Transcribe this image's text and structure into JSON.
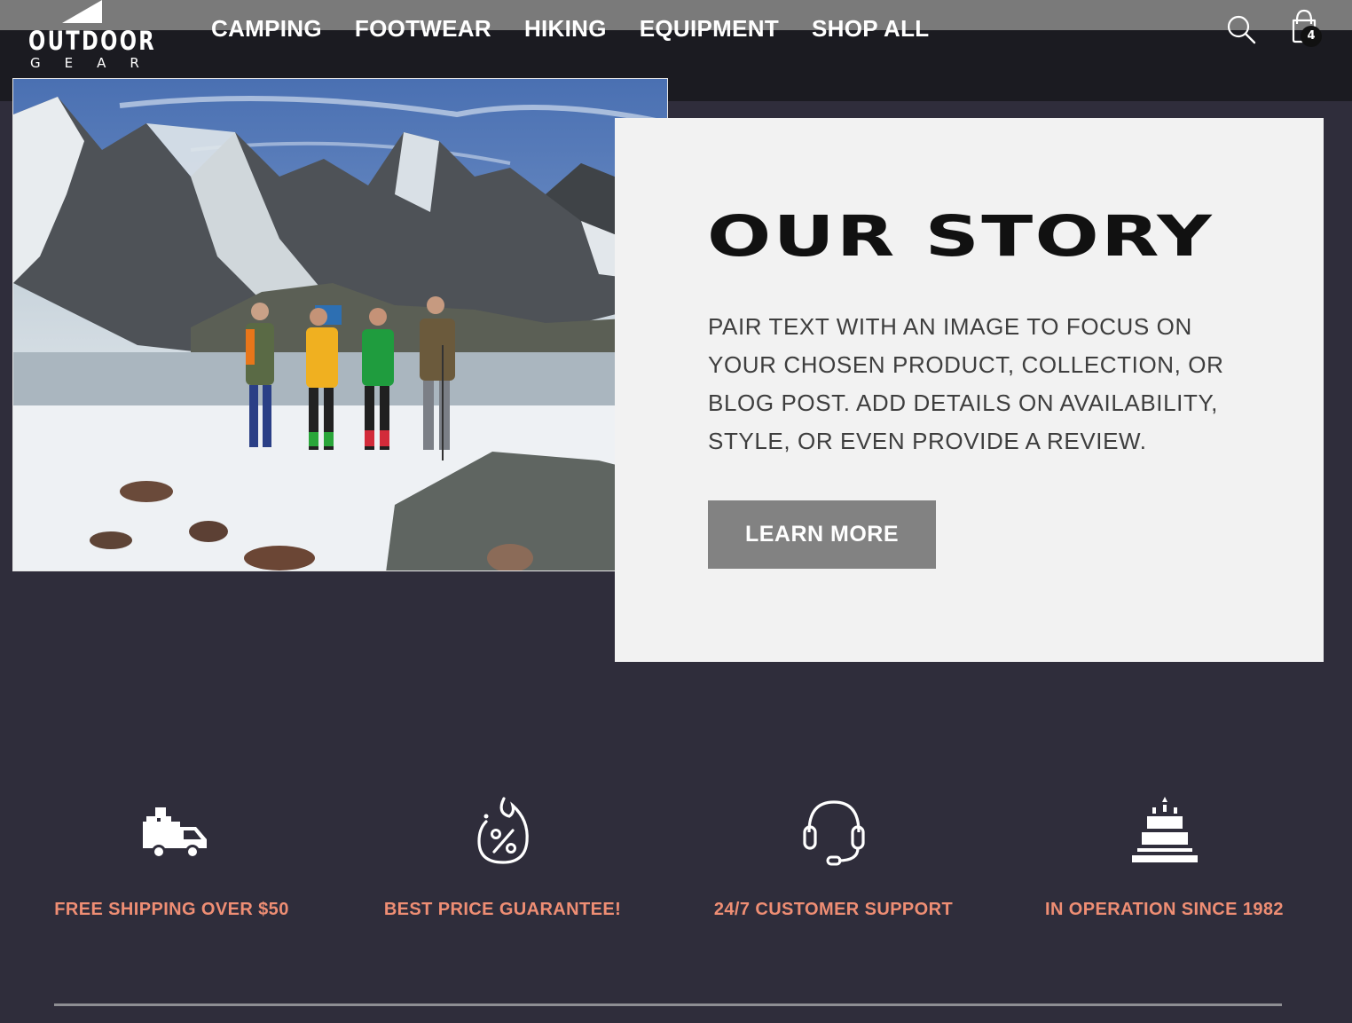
{
  "header": {
    "logo": {
      "word": "OUTDOOR",
      "sub": "GEAR"
    },
    "nav": [
      "CAMPING",
      "FOOTWEAR",
      "HIKING",
      "EQUIPMENT",
      "SHOP ALL"
    ],
    "icons": {
      "search": "search-icon",
      "cart": "shopping-bag-icon"
    },
    "cart_count": "4"
  },
  "hero": {
    "image_icon": "mountain-hikers-photo",
    "title": "OUR STORY",
    "text": "PAIR TEXT WITH AN IMAGE TO FOCUS ON YOUR CHOSEN PRODUCT, COLLECTION, OR BLOG POST. ADD DETAILS ON AVAILABILITY, STYLE, OR EVEN PROVIDE A REVIEW.",
    "button": "LEARN MORE"
  },
  "features": [
    {
      "icon": "delivery-truck-icon",
      "label": "FREE SHIPPING OVER $50"
    },
    {
      "icon": "discount-flame-icon",
      "label": "BEST PRICE GUARANTEE!"
    },
    {
      "icon": "headset-icon",
      "label": "24/7 CUSTOMER SUPPORT"
    },
    {
      "icon": "birthday-cake-icon",
      "label": "IN OPERATION SINCE 1982"
    }
  ],
  "colors": {
    "background": "#2f2d3b",
    "header": "#1b1b21",
    "card": "#f2f2f2",
    "accent": "#ef8e74",
    "button": "#828282"
  }
}
